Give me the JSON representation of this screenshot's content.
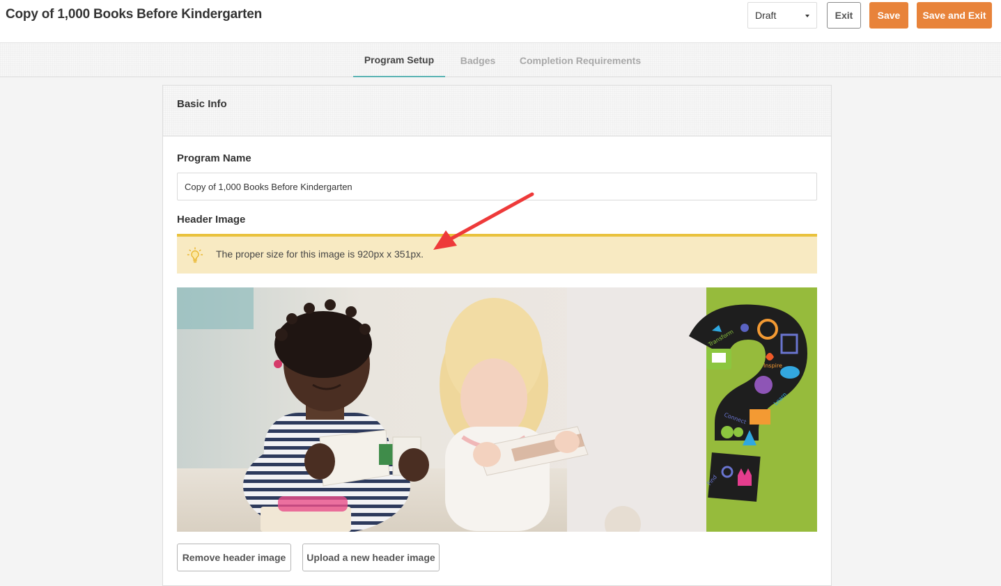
{
  "header": {
    "title": "Copy of 1,000 Books Before Kindergarten",
    "status_value": "Draft",
    "exit_label": "Exit",
    "save_label": "Save",
    "save_exit_label": "Save and Exit"
  },
  "tabs": [
    {
      "label": "Program Setup",
      "active": true
    },
    {
      "label": "Badges",
      "active": false
    },
    {
      "label": "Completion Requirements",
      "active": false
    }
  ],
  "card": {
    "title": "Basic Info",
    "program_name_label": "Program Name",
    "program_name_value": "Copy of 1,000 Books Before Kindergarten",
    "header_image_label": "Header Image",
    "tip_text": "The proper size for this image is 920px x 351px.",
    "remove_image_label": "Remove header image",
    "upload_image_label": "Upload a new header image"
  },
  "banner": {
    "words": [
      "Transform",
      "Inspire",
      "Connect",
      "Learn",
      "Find"
    ]
  },
  "colors": {
    "accent_orange": "#e8833a",
    "tab_underline": "#5bb3b3",
    "tip_background": "#f8eac2",
    "tip_border": "#e9c23d",
    "banner_green": "#96bb3c",
    "annotation_red": "#ee3a3a"
  },
  "icons": {
    "tip": "lightbulb-icon",
    "status_caret": "caret-down-icon",
    "annotation": "arrow-annotation"
  }
}
